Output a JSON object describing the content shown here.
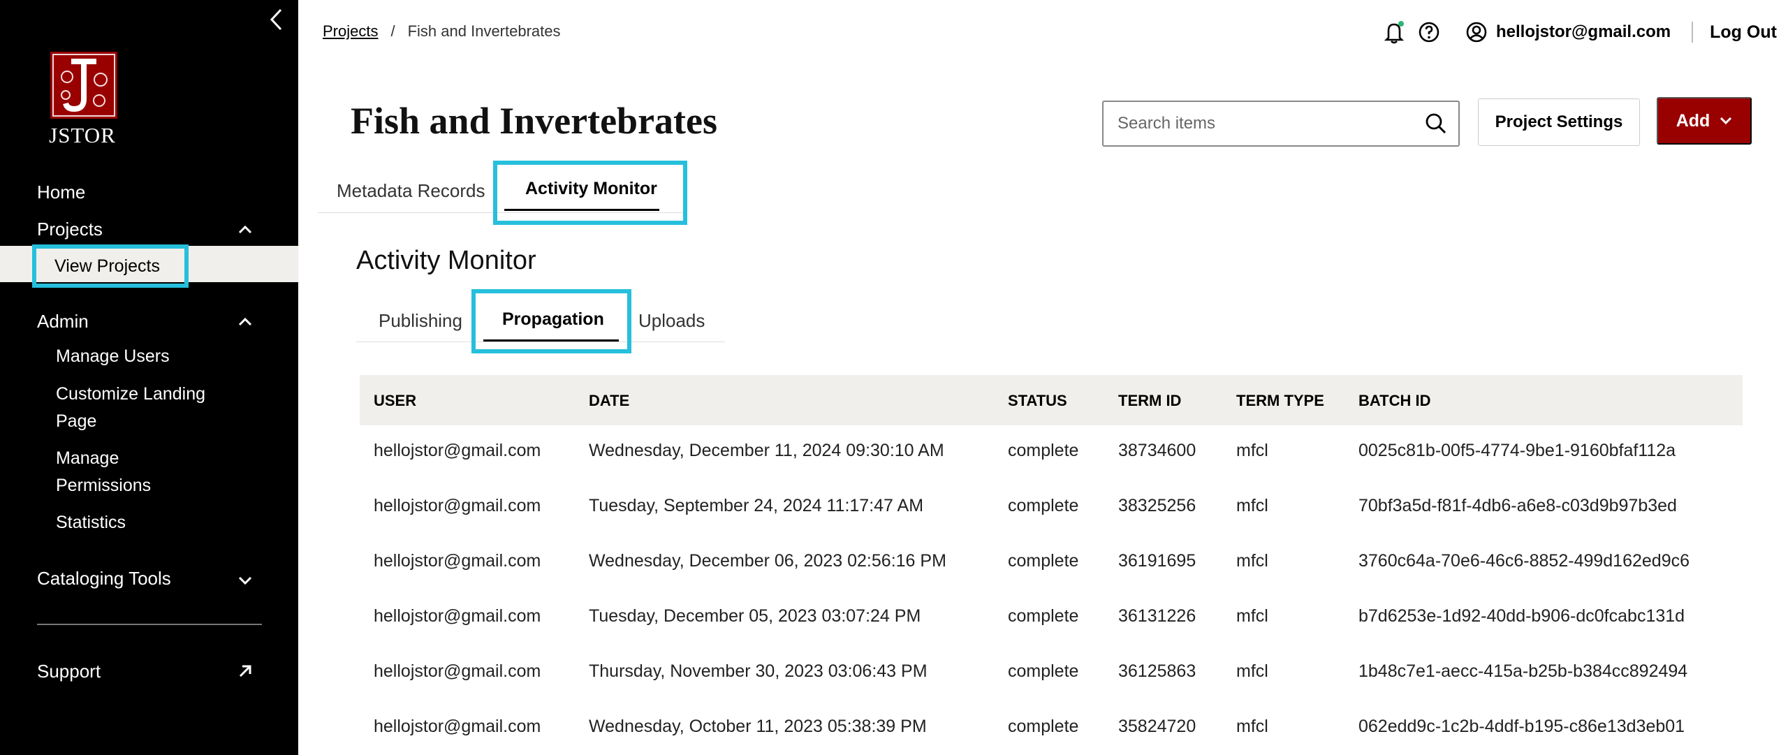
{
  "sidebar": {
    "logo_text": "JSTOR",
    "home": "Home",
    "projects": "Projects",
    "view_projects": "View Projects",
    "admin": "Admin",
    "manage_users": "Manage Users",
    "customize_landing_1": "Customize Landing",
    "customize_landing_2": "Page",
    "manage_permissions_1": "Manage",
    "manage_permissions_2": "Permissions",
    "statistics": "Statistics",
    "cataloging_tools": "Cataloging Tools",
    "support": "Support"
  },
  "breadcrumb": {
    "root": "Projects",
    "separator": "/",
    "current": "Fish and Invertebrates"
  },
  "topbar": {
    "user_email": "hellojstor@gmail.com",
    "logout": "Log Out"
  },
  "header": {
    "title": "Fish and Invertebrates",
    "search_placeholder": "Search items",
    "settings_label": "Project Settings",
    "add_label": "Add"
  },
  "tabs": {
    "metadata": "Metadata Records",
    "activity": "Activity Monitor"
  },
  "section_title": "Activity Monitor",
  "subtabs": {
    "publishing": "Publishing",
    "propagation": "Propagation",
    "uploads": "Uploads"
  },
  "table": {
    "headers": [
      "USER",
      "DATE",
      "STATUS",
      "TERM ID",
      "TERM TYPE",
      "BATCH ID"
    ],
    "rows": [
      [
        "hellojstor@gmail.com",
        "Wednesday, December 11, 2024 09:30:10 AM",
        "complete",
        "38734600",
        "mfcl",
        "0025c81b-00f5-4774-9be1-9160bfaf112a"
      ],
      [
        "hellojstor@gmail.com",
        "Tuesday, September 24, 2024 11:17:47 AM",
        "complete",
        "38325256",
        "mfcl",
        "70bf3a5d-f81f-4db6-a6e8-c03d9b97b3ed"
      ],
      [
        "hellojstor@gmail.com",
        "Wednesday, December 06, 2023 02:56:16 PM",
        "complete",
        "36191695",
        "mfcl",
        "3760c64a-70e6-46c6-8852-499d162ed9c6"
      ],
      [
        "hellojstor@gmail.com",
        "Tuesday, December 05, 2023 03:07:24 PM",
        "complete",
        "36131226",
        "mfcl",
        "b7d6253e-1d92-40dd-b906-dc0fcabc131d"
      ],
      [
        "hellojstor@gmail.com",
        "Thursday, November 30, 2023 03:06:43 PM",
        "complete",
        "36125863",
        "mfcl",
        "1b48c7e1-aecc-415a-b25b-b384cc892494"
      ],
      [
        "hellojstor@gmail.com",
        "Wednesday, October 11, 2023 05:38:39 PM",
        "complete",
        "35824720",
        "mfcl",
        "062edd9c-1c2b-4ddf-b195-c86e13d3eb01"
      ]
    ]
  },
  "colors": {
    "brand_red": "#990000",
    "highlight": "#26bfdc",
    "sidebar_bg": "#000000",
    "header_row_bg": "#f1efeb"
  },
  "icons": [
    "chevron-left-icon",
    "jstor-logo",
    "chevron-up-icon",
    "chevron-down-icon",
    "external-arrow-icon",
    "bell-icon",
    "help-icon",
    "user-circle-icon",
    "search-icon"
  ]
}
